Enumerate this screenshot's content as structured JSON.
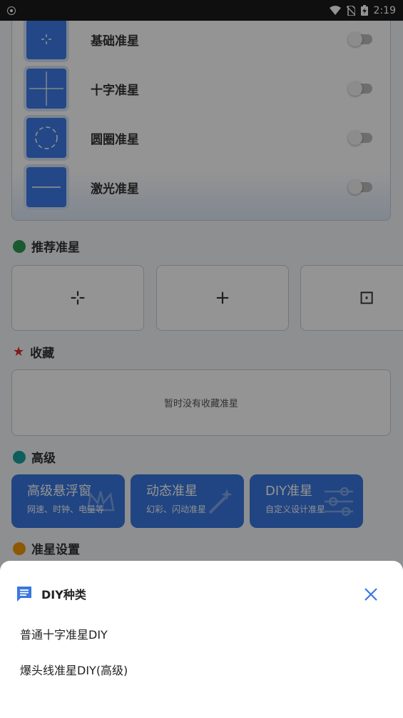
{
  "status": {
    "time": "2:19"
  },
  "crosshairs": [
    {
      "name": "基础准星",
      "enabled": false
    },
    {
      "name": "十字准星",
      "enabled": false
    },
    {
      "name": "圆圈准星",
      "enabled": false
    },
    {
      "name": "激光准星",
      "enabled": false
    }
  ],
  "sections": {
    "recommended": "推荐准星",
    "favorites": "收藏",
    "advanced": "高级",
    "settings": "准星设置"
  },
  "recommended_items": [
    "⊹",
    "+",
    "⊡"
  ],
  "favorites_empty": "暂时没有收藏准星",
  "advanced_cards": [
    {
      "title": "高级悬浮窗",
      "subtitle": "网速、时钟、电量等"
    },
    {
      "title": "动态准星",
      "subtitle": "幻彩、闪动准星"
    },
    {
      "title": "DIY准星",
      "subtitle": "自定义设计准星"
    }
  ],
  "sheet": {
    "title": "DIY种类",
    "items": [
      "普通十字准星DIY",
      "爆头线准星DIY(高级)"
    ]
  },
  "colors": {
    "primary": "#3a77e0",
    "section_green": "#2e9b55",
    "section_red": "#d93025",
    "section_teal": "#1aa3a3",
    "section_orange": "#f29900",
    "close": "#3a77e0"
  }
}
